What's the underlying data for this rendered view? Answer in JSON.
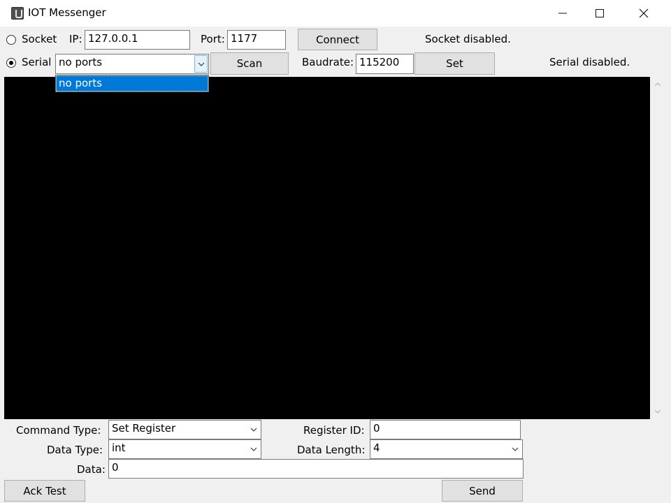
{
  "window": {
    "title": "IOT Messenger",
    "icons": [
      "app-icon",
      "minimize-icon",
      "maximize-icon",
      "close-icon"
    ]
  },
  "socket_row": {
    "radio_label": "Socket",
    "ip_label": "IP:",
    "ip_value": "127.0.0.1",
    "port_label": "Port:",
    "port_value": "1177",
    "connect_label": "Connect",
    "status": "Socket disabled."
  },
  "serial_row": {
    "radio_label": "Serial",
    "port_selected": "no ports",
    "scan_label": "Scan",
    "baudrate_label": "Baudrate:",
    "baudrate_value": "115200",
    "set_label": "Set",
    "status": "Serial disabled."
  },
  "port_dropdown": {
    "options": [
      "no ports"
    ]
  },
  "command_panel": {
    "command_type_label": "Command Type:",
    "command_type_value": "Set Register",
    "register_id_label": "Register ID:",
    "register_id_value": "0",
    "data_type_label": "Data Type:",
    "data_type_value": "int",
    "data_length_label": "Data Length:",
    "data_length_value": "4",
    "data_label": "Data:",
    "data_value": "0",
    "ack_test_label": "Ack Test",
    "send_label": "Send"
  },
  "selection": {
    "socket_selected": false,
    "serial_selected": true
  }
}
